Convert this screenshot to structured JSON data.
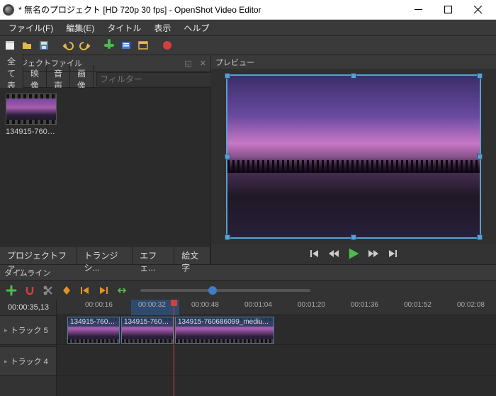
{
  "title": "* 無名のプロジェクト [HD 720p 30 fps] - OpenShot Video Editor",
  "menu": {
    "file": "ファイル(F)",
    "edit": "編集(E)",
    "title": "タイトル",
    "view": "表示",
    "help": "ヘルプ"
  },
  "panels": {
    "project_files": "プロジェクトファイル",
    "preview": "プレビュー",
    "timeline": "タイムライン"
  },
  "filter_tabs": {
    "all": "全て表示",
    "video": "映像",
    "audio": "音声",
    "image": "画像"
  },
  "filter_placeholder": "フィルター",
  "project_thumb_label": "134915-7606...",
  "bottom_tabs": {
    "project": "プロジェクトファ...",
    "transitions": "トランジシ...",
    "effects": "エフェ...",
    "emoji": "絵文字"
  },
  "timecode": "00:00:35,13",
  "ruler": [
    "00:00:16",
    "00:00:32",
    "00:00:48",
    "00:01:04",
    "00:01:20",
    "00:01:36",
    "00:01:52",
    "00:02:08"
  ],
  "tracks": {
    "t5": "トラック 5",
    "t4": "トラック 4"
  },
  "clips": {
    "c1": "134915-760686...",
    "c2": "134915-760686...",
    "c3": "134915-760686099_mediu..."
  }
}
